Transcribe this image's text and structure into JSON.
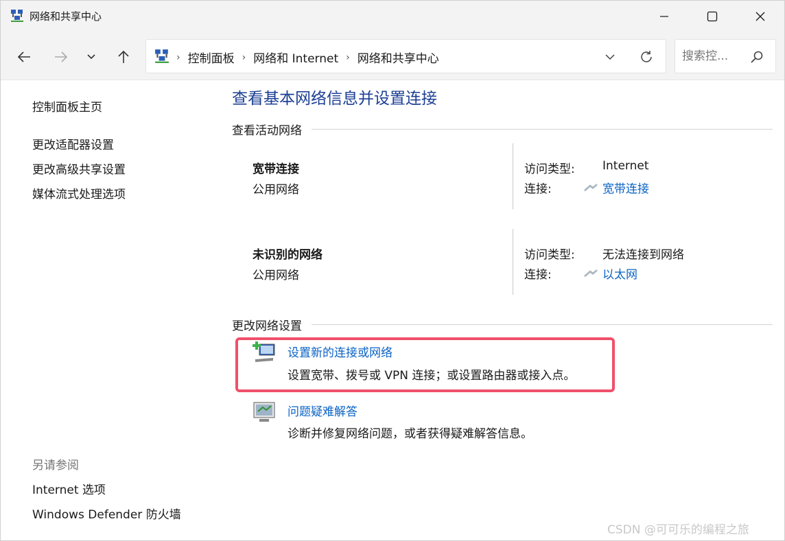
{
  "window": {
    "title": "网络和共享中心"
  },
  "nav": {
    "breadcrumbs": [
      "控制面板",
      "网络和 Internet",
      "网络和共享中心"
    ],
    "search_placeholder": "搜索控..."
  },
  "left_pane": {
    "home": "控制面板主页",
    "links": [
      "更改适配器设置",
      "更改高级共享设置",
      "媒体流式处理选项"
    ],
    "see_also_label": "另请参阅",
    "see_also": [
      "Internet 选项",
      "Windows Defender 防火墙"
    ]
  },
  "main": {
    "title": "查看基本网络信息并设置连接",
    "active_networks_label": "查看活动网络",
    "networks": [
      {
        "name": "宽带连接",
        "category": "公用网络",
        "access_label": "访问类型:",
        "access_value": "Internet",
        "conn_label": "连接:",
        "conn_value": "宽带连接"
      },
      {
        "name": "未识别的网络",
        "category": "公用网络",
        "access_label": "访问类型:",
        "access_value": "无法连接到网络",
        "conn_label": "连接:",
        "conn_value": "以太网"
      }
    ],
    "change_settings_label": "更改网络设置",
    "tasks": [
      {
        "link": "设置新的连接或网络",
        "desc": "设置宽带、拨号或 VPN 连接；或设置路由器或接入点。"
      },
      {
        "link": "问题疑难解答",
        "desc": "诊断并修复网络问题，或者获得疑难解答信息。"
      }
    ]
  },
  "watermark": "CSDN @可可乐的编程之旅",
  "colors": {
    "link": "#0b63c4",
    "title": "#1c3f94",
    "highlight": "#f0506a"
  }
}
